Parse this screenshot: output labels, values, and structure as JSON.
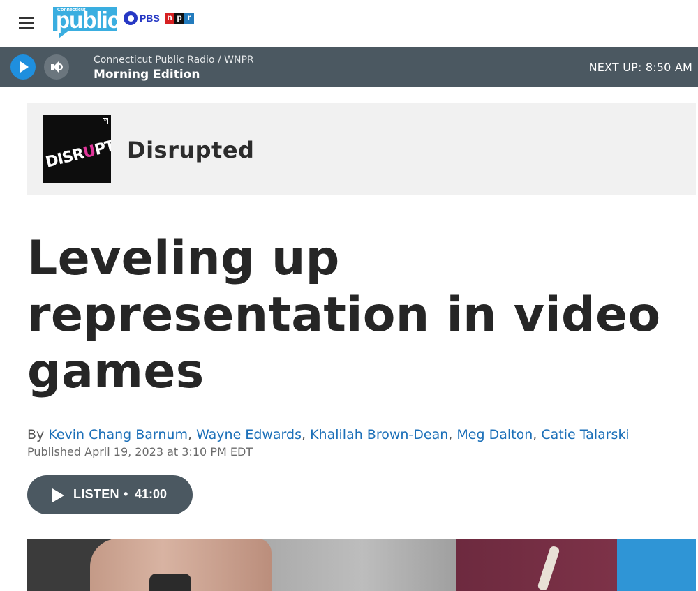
{
  "header": {
    "menu_icon": "hamburger-menu-icon",
    "logo": {
      "small_text": "Connecticut",
      "big_text": "public"
    },
    "partners": {
      "pbs": "PBS",
      "npr_letters": [
        "n",
        "p",
        "r"
      ]
    }
  },
  "player": {
    "station": "Connecticut Public Radio / WNPR",
    "program": "Morning Edition",
    "next_up": "NEXT UP: 8:50 AM",
    "play_icon": "play-icon",
    "volume_icon": "volume-icon",
    "colors": {
      "bar": "#4b5861",
      "play": "#1f8fde"
    }
  },
  "program_box": {
    "name": "Disrupted",
    "art_text_parts": [
      "DISR",
      "U",
      "PTED"
    ]
  },
  "article": {
    "headline": "Leveling up representation in video games",
    "by_label": "By",
    "authors": [
      "Kevin Chang Barnum",
      "Wayne Edwards",
      "Khalilah Brown-Dean",
      "Meg Dalton",
      "Catie Talarski"
    ],
    "published": "Published April 19, 2023 at 3:10 PM EDT"
  },
  "listen": {
    "label": "LISTEN",
    "separator": "•",
    "duration": "41:00"
  },
  "colors": {
    "link": "#1b6fb8",
    "text": "#262626",
    "box_bg": "#f1f1f1"
  }
}
